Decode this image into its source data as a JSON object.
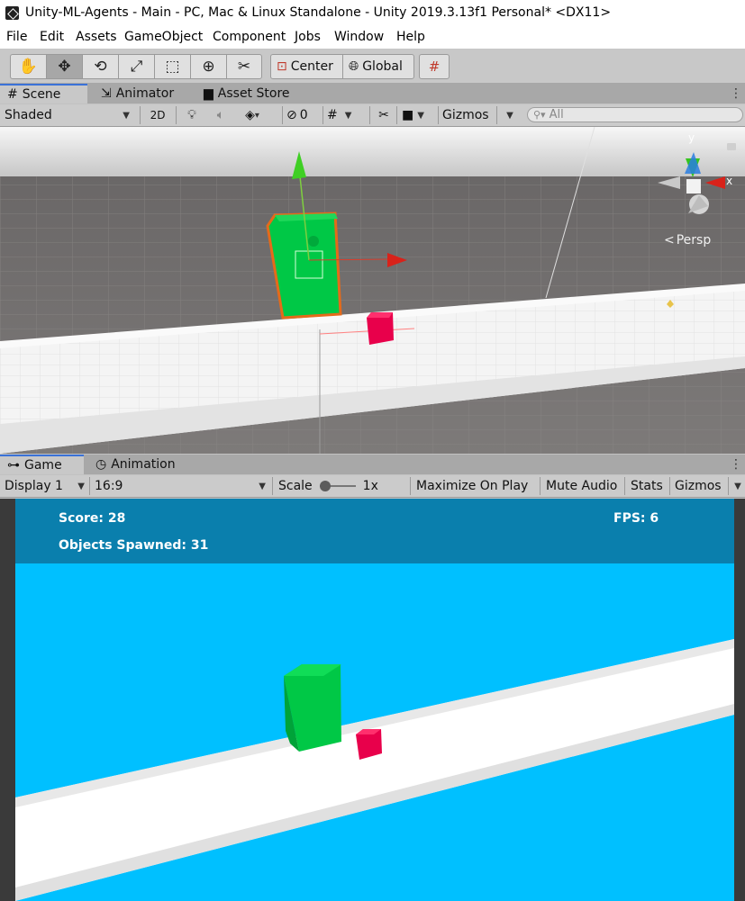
{
  "window": {
    "title": "Unity-ML-Agents - Main - PC, Mac & Linux Standalone - Unity 2019.3.13f1 Personal* <DX11>"
  },
  "menu": [
    "File",
    "Edit",
    "Assets",
    "GameObject",
    "Component",
    "Jobs",
    "Window",
    "Help"
  ],
  "toolbar": {
    "tools": [
      "hand-tool-icon",
      "move-tool-icon",
      "rotate-tool-icon",
      "scale-tool-icon",
      "rect-tool-icon",
      "transform-tool-icon",
      "custom-tool-icon"
    ],
    "pivot_label": "Center",
    "space_label": "Global"
  },
  "scene_tabs": [
    {
      "label": "Scene",
      "icon": "grid-icon"
    },
    {
      "label": "Animator",
      "icon": "animator-icon"
    },
    {
      "label": "Asset Store",
      "icon": "bag-icon"
    }
  ],
  "scene_controls": {
    "shading": "Shaded",
    "mode_2d": "2D",
    "hidden_count": "0",
    "gizmos": "Gizmos",
    "search_placeholder": "All"
  },
  "scene_view": {
    "persp_label": "Persp",
    "axis_y": "y",
    "axis_x": "x"
  },
  "game_tabs": [
    {
      "label": "Game",
      "icon": "gamepad-icon"
    },
    {
      "label": "Animation",
      "icon": "clock-icon"
    }
  ],
  "game_controls": {
    "display": "Display 1",
    "aspect": "16:9",
    "scale_label": "Scale",
    "scale_value": "1x",
    "maximize": "Maximize On Play",
    "mute": "Mute Audio",
    "stats": "Stats",
    "gizmos": "Gizmos"
  },
  "hud": {
    "score": "Score: 28",
    "spawned": "Objects Spawned: 31",
    "fps": "FPS: 6"
  },
  "colors": {
    "hud_bar": "#0a7fad",
    "sky": "#00c0ff",
    "agent_green": "#00c846",
    "target_red": "#e8004b",
    "selection_orange": "#e56a1a"
  }
}
